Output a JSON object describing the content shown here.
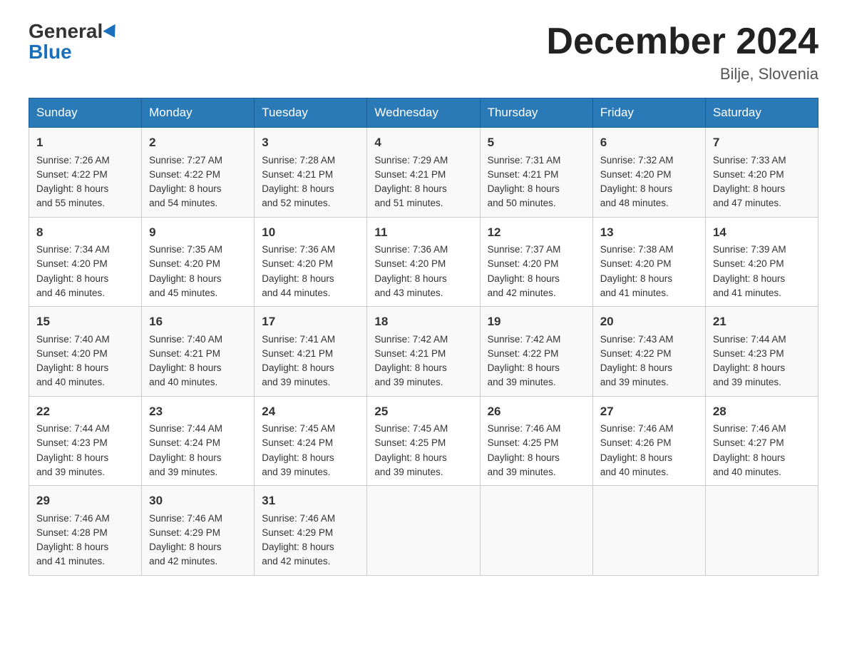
{
  "header": {
    "logo_general": "General",
    "logo_blue": "Blue",
    "month_title": "December 2024",
    "location": "Bilje, Slovenia"
  },
  "weekdays": [
    "Sunday",
    "Monday",
    "Tuesday",
    "Wednesday",
    "Thursday",
    "Friday",
    "Saturday"
  ],
  "weeks": [
    [
      {
        "day": "1",
        "sunrise": "7:26 AM",
        "sunset": "4:22 PM",
        "daylight": "8 hours and 55 minutes."
      },
      {
        "day": "2",
        "sunrise": "7:27 AM",
        "sunset": "4:22 PM",
        "daylight": "8 hours and 54 minutes."
      },
      {
        "day": "3",
        "sunrise": "7:28 AM",
        "sunset": "4:21 PM",
        "daylight": "8 hours and 52 minutes."
      },
      {
        "day": "4",
        "sunrise": "7:29 AM",
        "sunset": "4:21 PM",
        "daylight": "8 hours and 51 minutes."
      },
      {
        "day": "5",
        "sunrise": "7:31 AM",
        "sunset": "4:21 PM",
        "daylight": "8 hours and 50 minutes."
      },
      {
        "day": "6",
        "sunrise": "7:32 AM",
        "sunset": "4:20 PM",
        "daylight": "8 hours and 48 minutes."
      },
      {
        "day": "7",
        "sunrise": "7:33 AM",
        "sunset": "4:20 PM",
        "daylight": "8 hours and 47 minutes."
      }
    ],
    [
      {
        "day": "8",
        "sunrise": "7:34 AM",
        "sunset": "4:20 PM",
        "daylight": "8 hours and 46 minutes."
      },
      {
        "day": "9",
        "sunrise": "7:35 AM",
        "sunset": "4:20 PM",
        "daylight": "8 hours and 45 minutes."
      },
      {
        "day": "10",
        "sunrise": "7:36 AM",
        "sunset": "4:20 PM",
        "daylight": "8 hours and 44 minutes."
      },
      {
        "day": "11",
        "sunrise": "7:36 AM",
        "sunset": "4:20 PM",
        "daylight": "8 hours and 43 minutes."
      },
      {
        "day": "12",
        "sunrise": "7:37 AM",
        "sunset": "4:20 PM",
        "daylight": "8 hours and 42 minutes."
      },
      {
        "day": "13",
        "sunrise": "7:38 AM",
        "sunset": "4:20 PM",
        "daylight": "8 hours and 41 minutes."
      },
      {
        "day": "14",
        "sunrise": "7:39 AM",
        "sunset": "4:20 PM",
        "daylight": "8 hours and 41 minutes."
      }
    ],
    [
      {
        "day": "15",
        "sunrise": "7:40 AM",
        "sunset": "4:20 PM",
        "daylight": "8 hours and 40 minutes."
      },
      {
        "day": "16",
        "sunrise": "7:40 AM",
        "sunset": "4:21 PM",
        "daylight": "8 hours and 40 minutes."
      },
      {
        "day": "17",
        "sunrise": "7:41 AM",
        "sunset": "4:21 PM",
        "daylight": "8 hours and 39 minutes."
      },
      {
        "day": "18",
        "sunrise": "7:42 AM",
        "sunset": "4:21 PM",
        "daylight": "8 hours and 39 minutes."
      },
      {
        "day": "19",
        "sunrise": "7:42 AM",
        "sunset": "4:22 PM",
        "daylight": "8 hours and 39 minutes."
      },
      {
        "day": "20",
        "sunrise": "7:43 AM",
        "sunset": "4:22 PM",
        "daylight": "8 hours and 39 minutes."
      },
      {
        "day": "21",
        "sunrise": "7:44 AM",
        "sunset": "4:23 PM",
        "daylight": "8 hours and 39 minutes."
      }
    ],
    [
      {
        "day": "22",
        "sunrise": "7:44 AM",
        "sunset": "4:23 PM",
        "daylight": "8 hours and 39 minutes."
      },
      {
        "day": "23",
        "sunrise": "7:44 AM",
        "sunset": "4:24 PM",
        "daylight": "8 hours and 39 minutes."
      },
      {
        "day": "24",
        "sunrise": "7:45 AM",
        "sunset": "4:24 PM",
        "daylight": "8 hours and 39 minutes."
      },
      {
        "day": "25",
        "sunrise": "7:45 AM",
        "sunset": "4:25 PM",
        "daylight": "8 hours and 39 minutes."
      },
      {
        "day": "26",
        "sunrise": "7:46 AM",
        "sunset": "4:25 PM",
        "daylight": "8 hours and 39 minutes."
      },
      {
        "day": "27",
        "sunrise": "7:46 AM",
        "sunset": "4:26 PM",
        "daylight": "8 hours and 40 minutes."
      },
      {
        "day": "28",
        "sunrise": "7:46 AM",
        "sunset": "4:27 PM",
        "daylight": "8 hours and 40 minutes."
      }
    ],
    [
      {
        "day": "29",
        "sunrise": "7:46 AM",
        "sunset": "4:28 PM",
        "daylight": "8 hours and 41 minutes."
      },
      {
        "day": "30",
        "sunrise": "7:46 AM",
        "sunset": "4:29 PM",
        "daylight": "8 hours and 42 minutes."
      },
      {
        "day": "31",
        "sunrise": "7:46 AM",
        "sunset": "4:29 PM",
        "daylight": "8 hours and 42 minutes."
      },
      null,
      null,
      null,
      null
    ]
  ]
}
